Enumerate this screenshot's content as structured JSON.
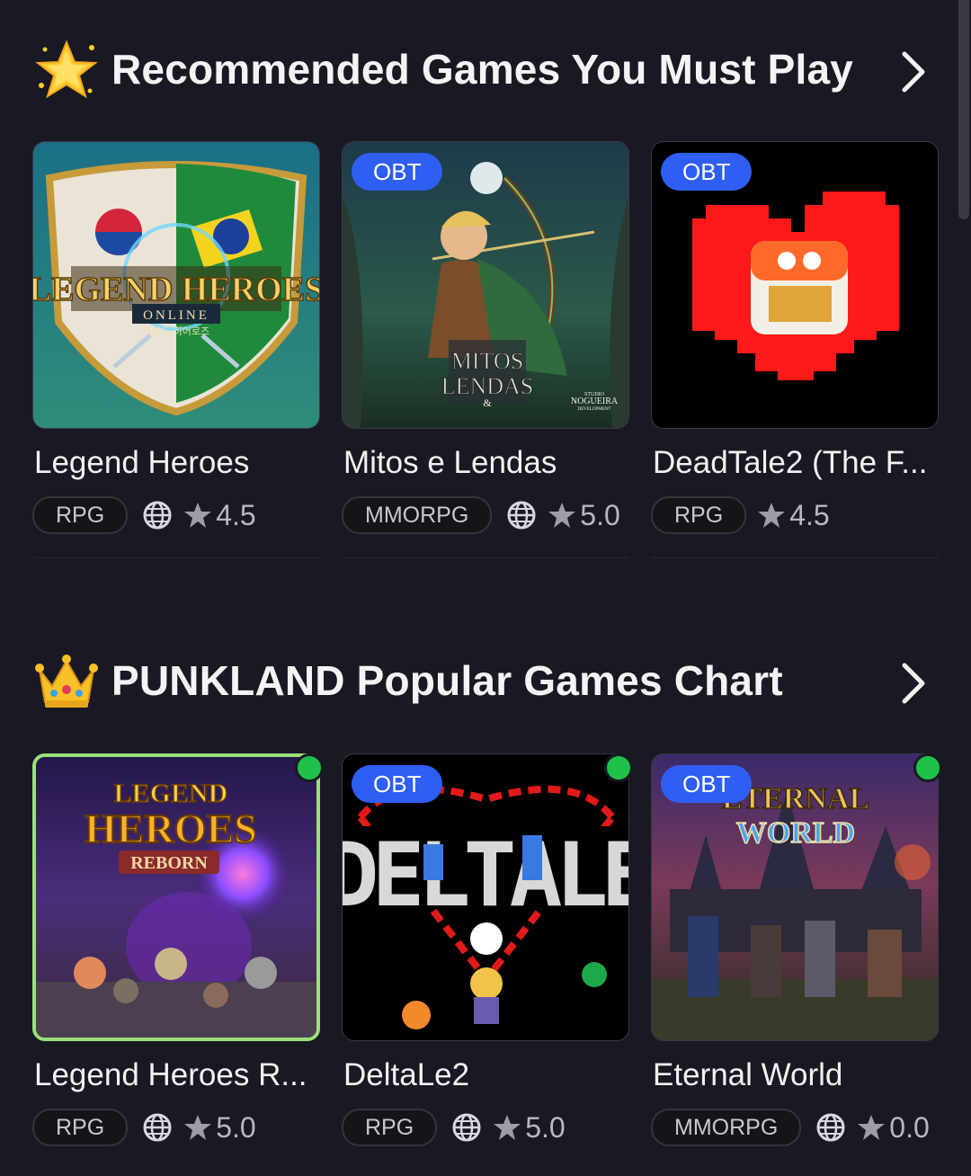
{
  "sections": [
    {
      "title": "Recommended Games You Must Play",
      "icon": "sparkle-star-icon",
      "games": [
        {
          "title": "Legend Heroes",
          "genre": "RPG",
          "rating": "4.5",
          "badge": "",
          "online": false,
          "art_text": [
            "LEGEND HEROES",
            "ONLINE",
            "레전드 히어로즈"
          ]
        },
        {
          "title": "Mitos e Lendas",
          "genre": "MMORPG",
          "rating": "5.0",
          "badge": "OBT",
          "online": false,
          "art_text": [
            "MITOS",
            "LENDAS",
            "&",
            "STUDIO",
            "NOGUEIRA",
            "DEVELOPMENT"
          ]
        },
        {
          "title": "DeadTale2 (The F...",
          "genre": "RPG",
          "rating": "4.5",
          "badge": "OBT",
          "online": false,
          "art_text": []
        }
      ]
    },
    {
      "title": "PUNKLAND Popular Games Chart",
      "icon": "crown-icon",
      "games": [
        {
          "title": "Legend Heroes R...",
          "genre": "RPG",
          "rating": "5.0",
          "badge": "",
          "online": true,
          "art_text": [
            "LEGEND",
            "HEROES",
            "REBORN"
          ]
        },
        {
          "title": "DeltaLe2",
          "genre": "RPG",
          "rating": "5.0",
          "badge": "OBT",
          "online": true,
          "art_text": [
            "DELTALE"
          ]
        },
        {
          "title": "Eternal World",
          "genre": "MMORPG",
          "rating": "0.0",
          "badge": "OBT",
          "online": true,
          "art_text": [
            "ETERNAL",
            "WORLD"
          ]
        }
      ]
    }
  ],
  "colors": {
    "background": "#191923",
    "badge": "#2f5ef2",
    "online": "#1ec24a",
    "active_border": "#9be07a"
  }
}
